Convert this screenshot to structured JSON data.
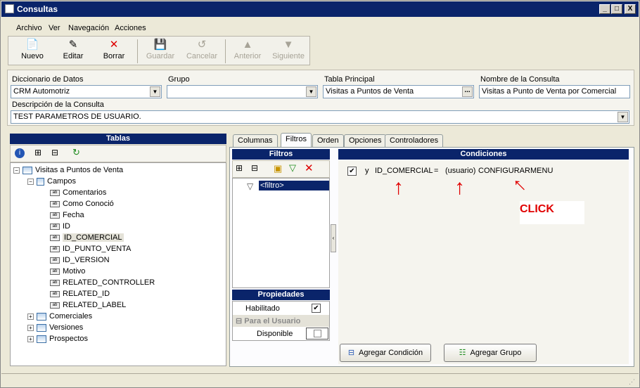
{
  "window": {
    "title": "Consultas",
    "min": "_",
    "max": "□",
    "close": "X"
  },
  "menu": [
    "Archivo",
    "Ver",
    "Navegación",
    "Acciones"
  ],
  "toolbar": {
    "nuevo": "Nuevo",
    "editar": "Editar",
    "borrar": "Borrar",
    "guardar": "Guardar",
    "cancelar": "Cancelar",
    "anterior": "Anterior",
    "siguiente": "Siguiente"
  },
  "form": {
    "diccionario_label": "Diccionario de Datos",
    "diccionario_value": "CRM Automotriz",
    "grupo_label": "Grupo",
    "grupo_value": "",
    "tabla_label": "Tabla Principal",
    "tabla_value": "Visitas a Puntos de Venta",
    "tabla_btn": "...",
    "nombre_label": "Nombre de la Consulta",
    "nombre_value": "Visitas a Punto de Venta por Comercial",
    "descripcion_label": "Descripción de la Consulta",
    "descripcion_value": "TEST PARAMETROS DE USUARIO."
  },
  "tablas": {
    "header": "Tablas",
    "root": "Visitas a Puntos de Venta",
    "campos": "Campos",
    "fields": [
      "Comentarios",
      "Como Conoció",
      "Fecha",
      "ID",
      "ID_COMERCIAL",
      "ID_PUNTO_VENTA",
      "ID_VERSION",
      "Motivo",
      "RELATED_CONTROLLER",
      "RELATED_ID",
      "RELATED_LABEL"
    ],
    "others": [
      "Comerciales",
      "Versiones",
      "Prospectos"
    ]
  },
  "tabs": [
    "Columnas",
    "Filtros",
    "Orden",
    "Opciones",
    "Controladores"
  ],
  "filtros": {
    "header": "Filtros",
    "item": "<filtro>"
  },
  "propiedades": {
    "header": "Propiedades",
    "habilitado": "Habilitado",
    "para_usuario": "Para el Usuario",
    "disponible": "Disponible"
  },
  "condiciones": {
    "header": "Condiciones",
    "y": "y",
    "campo": "ID_COMERCIAL",
    "op": "=",
    "valor": "(usuario)",
    "configurar": "CONFIGURAR",
    "menu": "MENU"
  },
  "annotation": {
    "click": "CLICK"
  },
  "buttons": {
    "agregar_condicion": "Agregar Condición",
    "agregar_grupo": "Agregar Grupo"
  },
  "colors": {
    "header": "#0a246a",
    "annotation": "#e00000"
  }
}
